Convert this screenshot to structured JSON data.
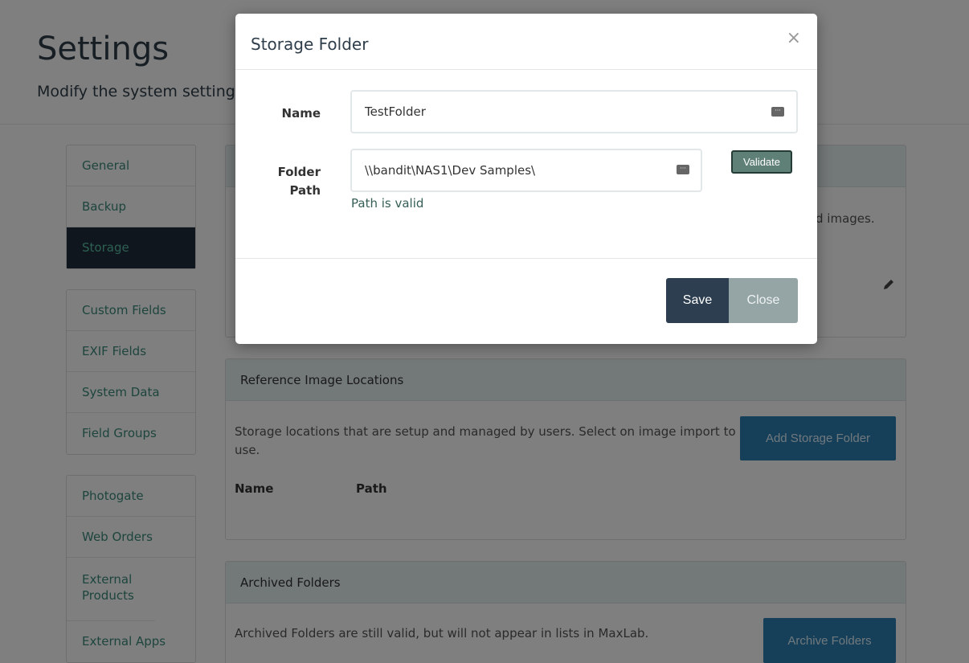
{
  "page": {
    "title": "Settings",
    "subtitle": "Modify the system settings"
  },
  "sidebar": {
    "group1": [
      {
        "label": "General"
      },
      {
        "label": "Backup"
      },
      {
        "label": "Storage",
        "active": true
      }
    ],
    "group2": [
      {
        "label": "Custom Fields"
      },
      {
        "label": "EXIF Fields"
      },
      {
        "label": "System Data"
      },
      {
        "label": "Field Groups"
      }
    ],
    "group3": [
      {
        "label": "Photogate"
      },
      {
        "label": "Web Orders"
      },
      {
        "label": "External Products"
      },
      {
        "label": "External Apps"
      }
    ]
  },
  "top_panel": {
    "desc_fragment": "d images."
  },
  "reference_panel": {
    "title": "Reference Image Locations",
    "description": "Storage locations that are setup and managed by users. Select on image import to use.",
    "add_button": "Add Storage Folder",
    "columns": [
      "Name",
      "Path"
    ]
  },
  "archived_panel": {
    "title": "Archived Folders",
    "description": "Archived Folders are still valid, but will not appear in lists in MaxLab.",
    "archive_button": "Archive Folders"
  },
  "modal": {
    "title": "Storage Folder",
    "close_symbol": "×",
    "name_label": "Name",
    "name_value": "TestFolder",
    "path_label": "Folder Path",
    "path_value": "\\\\bandit\\NAS1\\Dev Samples\\",
    "validate_label": "Validate",
    "path_status": "Path is valid",
    "save_label": "Save",
    "close_label": "Close"
  },
  "colors": {
    "active_nav_bg": "#1e2d3b",
    "nav_link": "#3a8a7a",
    "primary_button": "#2c7fb3",
    "save_button": "#2d3e50",
    "close_button": "#95a5a6",
    "panel_header": "#e7f0f1"
  },
  "icons": {
    "keyboard": "keyboard-icon",
    "edit": "pencil-icon",
    "close": "close-icon"
  }
}
